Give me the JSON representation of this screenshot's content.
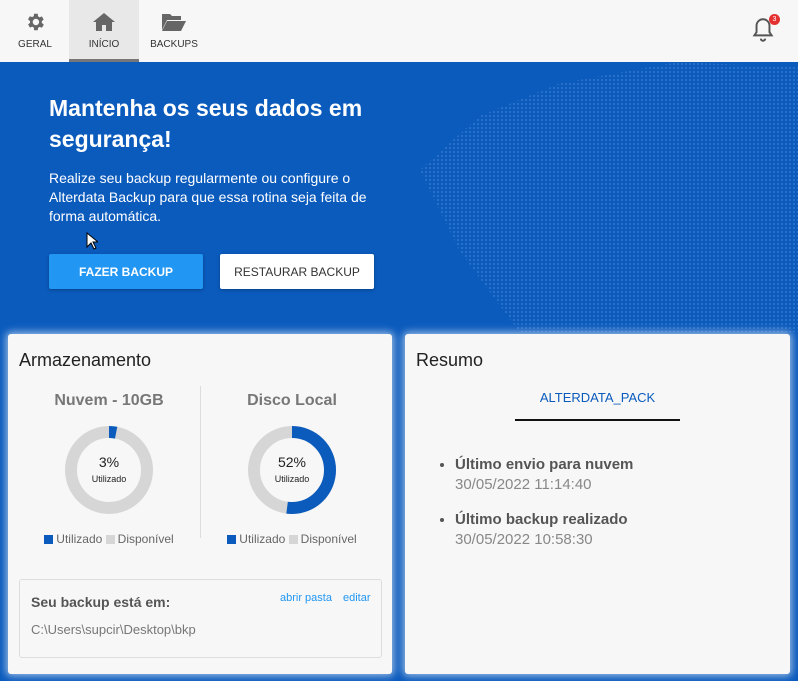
{
  "nav": {
    "tabs": [
      {
        "label": "GERAL",
        "icon": "gear-icon"
      },
      {
        "label": "INÍCIO",
        "icon": "home-icon"
      },
      {
        "label": "BACKUPS",
        "icon": "folder-open-icon"
      }
    ],
    "active": "INÍCIO",
    "notifications": "3"
  },
  "hero": {
    "title": "Mantenha os seus dados em segurança!",
    "text": "Realize seu backup regularmente ou configure o Alterdata Backup para que essa rotina seja feita de forma automática.",
    "backup_button": "FAZER BACKUP",
    "restore_button": "RESTAURAR BACKUP"
  },
  "storage": {
    "title": "Armazenamento",
    "cloud": {
      "title": "Nuvem - 10GB",
      "percent_label": "3%",
      "percent": 3,
      "sub": "Utilizado"
    },
    "local": {
      "title": "Disco Local",
      "percent_label": "52%",
      "percent": 52,
      "sub": "Utilizado"
    },
    "legend": {
      "used": "Utilizado",
      "free": "Disponível"
    },
    "location": {
      "title": "Seu backup está em:",
      "path": "C:\\Users\\supcir\\Desktop\\bkp",
      "open_folder": "abrir pasta",
      "edit": "editar"
    }
  },
  "summary": {
    "title": "Resumo",
    "tab": "ALTERDATA_PACK",
    "items": [
      {
        "label": "Último envio para nuvem",
        "date": "30/05/2022 11:14:40"
      },
      {
        "label": "Último backup realizado",
        "date": "30/05/2022 10:58:30"
      }
    ]
  },
  "colors": {
    "brand": "#0b5bbd",
    "used": "#0b5bbd",
    "free": "#d6d6d6",
    "accent": "#2196f3"
  }
}
